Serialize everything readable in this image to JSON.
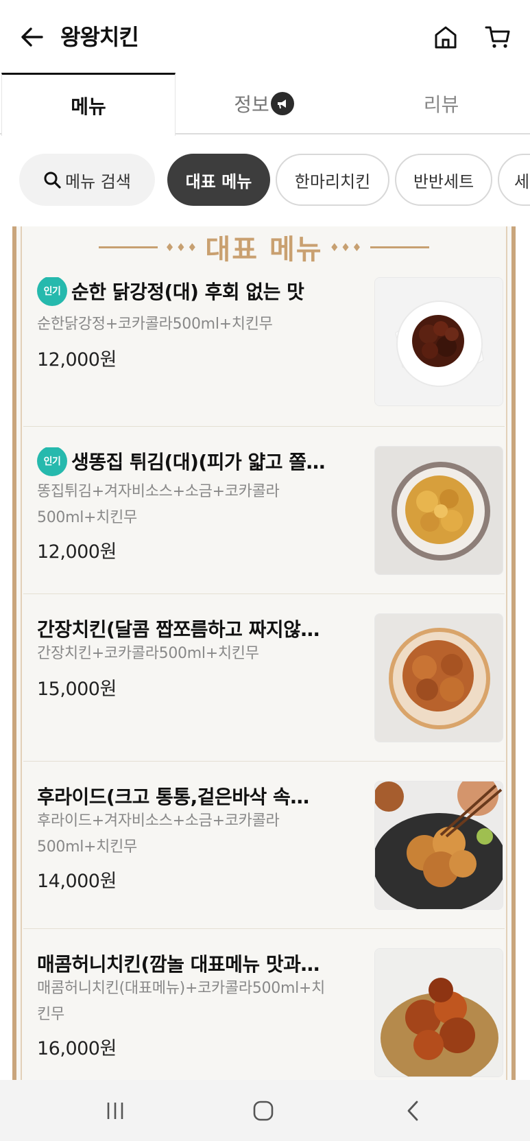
{
  "header": {
    "title": "왕왕치킨",
    "back_icon": "arrow-left-icon",
    "home_icon": "home-icon",
    "cart_icon": "cart-icon"
  },
  "tabs": [
    {
      "label": "메뉴",
      "active": true
    },
    {
      "label": "정보",
      "icon": "megaphone-icon"
    },
    {
      "label": "리뷰"
    }
  ],
  "chips": {
    "search_label": "메뉴 검색",
    "items": [
      {
        "label": "대표 메뉴",
        "active": true
      },
      {
        "label": "한마리치킨"
      },
      {
        "label": "반반세트"
      },
      {
        "label": "세"
      }
    ]
  },
  "board": {
    "title": "대표 메뉴",
    "deco": "♦♦♦"
  },
  "menu_items": [
    {
      "badge": "인기",
      "name": "순한 닭강정(대)  후회 없는 맛",
      "desc": "순한닭강정+코카콜라500ml+치킨무",
      "price": "12,000원"
    },
    {
      "badge": "인기",
      "name": "생똥집 튀김(대)(피가 얇고 쫄…",
      "desc": "똥집튀김+겨자비소스+소금+코카콜라500ml+치킨무",
      "price": "12,000원"
    },
    {
      "name": "간장치킨(달콤 짭쪼름하고 짜지않…",
      "desc": "간장치킨+코카콜라500ml+치킨무",
      "price": "15,000원"
    },
    {
      "name": "후라이드(크고 통통,겉은바삭 속…",
      "desc": "후라이드+겨자비소스+소금+코카콜라500ml+치킨무",
      "price": "14,000원"
    },
    {
      "name": "매콤허니치킨(깜놀 대표메뉴 맛과…",
      "desc": "매콤허니치킨(대표메뉴)+코카콜라500ml+치킨무",
      "price": "16,000원"
    }
  ],
  "colors": {
    "accent_gold": "#c9a070",
    "badge_teal": "#26b9ad",
    "active_chip": "#3d3d3d"
  },
  "navbar": {
    "recent_icon": "recent-apps-icon",
    "home_icon": "system-home-icon",
    "back_icon": "system-back-icon"
  }
}
